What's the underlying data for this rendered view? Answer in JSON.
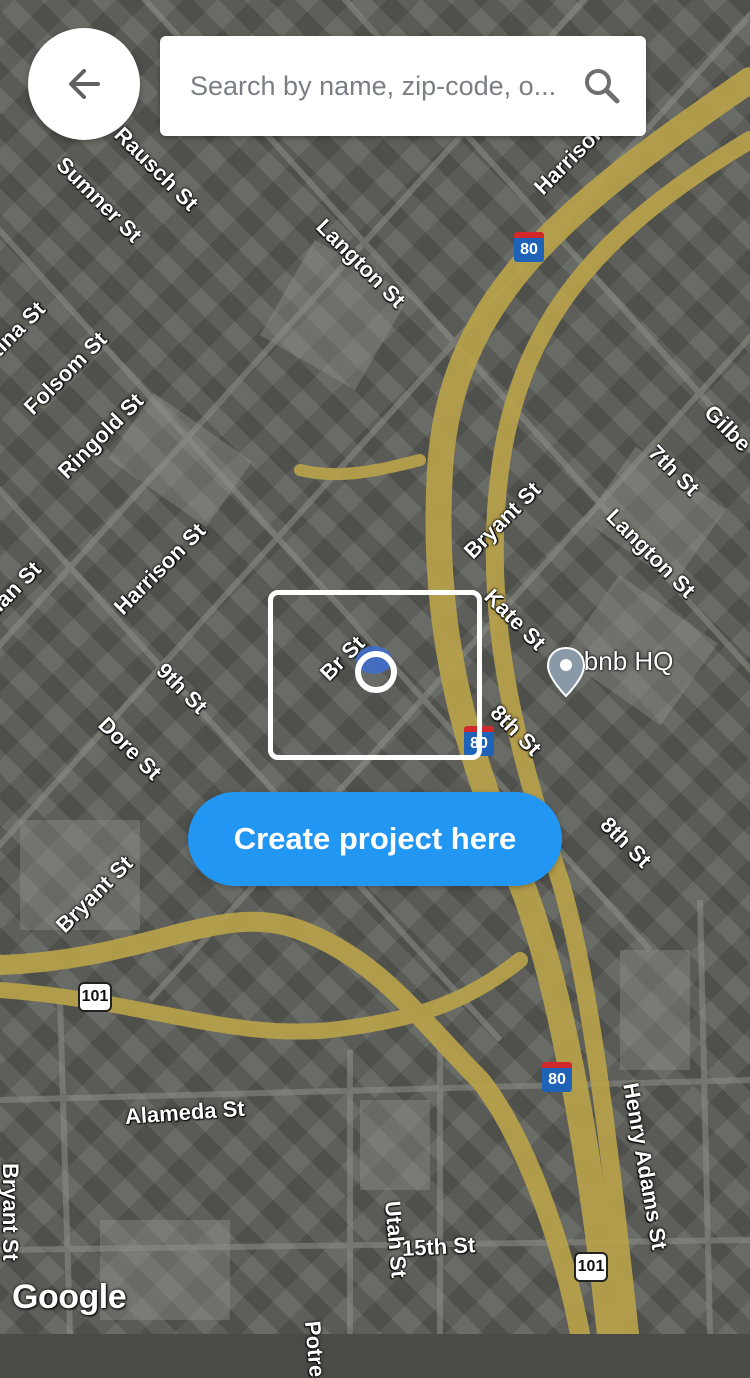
{
  "header": {
    "search_placeholder": "Search by name, zip-code, o..."
  },
  "map": {
    "street_labels": [
      "Rausch St",
      "Sumner St",
      "Langton St",
      "Harrison St",
      "Folsom St",
      "Ringold St",
      "tina St",
      "Gilbe",
      "7th St",
      "Langton St",
      "Bryant St",
      "Kate St",
      "Harrison St",
      "9th St",
      "Dore St",
      "dan St",
      "8th St",
      "8th St",
      "Bryant St",
      "Alameda St",
      "Bryant St",
      "Henry Adams St",
      "Utah St",
      "15th St",
      "Potre",
      "Br  St"
    ],
    "route_shields": [
      {
        "label": "80",
        "kind": "interstate"
      },
      {
        "label": "80",
        "kind": "interstate"
      },
      {
        "label": "80",
        "kind": "interstate"
      },
      {
        "label": "101",
        "kind": "us"
      },
      {
        "label": "101",
        "kind": "us"
      }
    ],
    "poi": {
      "label": "Airbnb HQ"
    },
    "attribution": "Google"
  },
  "actions": {
    "create_label": "Create project here"
  },
  "colors": {
    "primary": "#2196f3",
    "highway": "#b9a24a"
  }
}
